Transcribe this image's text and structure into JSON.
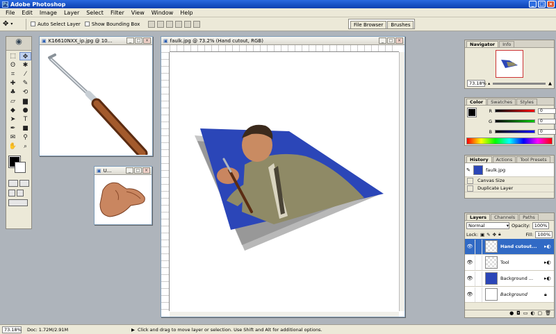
{
  "app": {
    "title": "Adobe Photoshop"
  },
  "menu": [
    "File",
    "Edit",
    "Image",
    "Layer",
    "Select",
    "Filter",
    "View",
    "Window",
    "Help"
  ],
  "options": {
    "auto_select_layer": "Auto Select Layer",
    "show_bounding_box": "Show Bounding Box",
    "file_browser": "File Browser",
    "brushes": "Brushes"
  },
  "docs": {
    "tool_doc": "K16610NXX_ip.jpg @ 10...",
    "hand_doc": "U...",
    "main_doc": "faulk.jpg @ 73.2% (Hand cutout, RGB)"
  },
  "navigator": {
    "tabs": [
      "Navigator",
      "Info"
    ],
    "zoom": "73.18%"
  },
  "color": {
    "tabs": [
      "Color",
      "Swatches",
      "Styles"
    ],
    "channels": [
      {
        "label": "R",
        "value": "0"
      },
      {
        "label": "G",
        "value": "0"
      },
      {
        "label": "B",
        "value": "0"
      }
    ]
  },
  "history": {
    "tabs": [
      "History",
      "Actions",
      "Tool Presets"
    ],
    "snapshot": "faulk.jpg",
    "steps": [
      "Canvas Size",
      "Duplicate Layer"
    ]
  },
  "layers": {
    "tabs": [
      "Layers",
      "Channels",
      "Paths"
    ],
    "blend_mode": "Normal",
    "opacity_label": "Opacity:",
    "opacity": "100%",
    "lock_label": "Lock:",
    "fill_label": "Fill:",
    "fill": "100%",
    "items": [
      {
        "name": "Hand cutout...",
        "selected": true
      },
      {
        "name": "Tool",
        "selected": false
      },
      {
        "name": "Background ...",
        "selected": false
      },
      {
        "name": "Background",
        "selected": false
      }
    ]
  },
  "status": {
    "zoom": "73.18%",
    "doc": "Doc: 1.72M/2.91M",
    "hint": "Click and drag to move layer or selection.  Use Shift and Alt for additional options."
  },
  "colors": {
    "titlebar": "#0a3fb0",
    "selection": "#316ac5",
    "photo_bg": "#2b46b8"
  }
}
